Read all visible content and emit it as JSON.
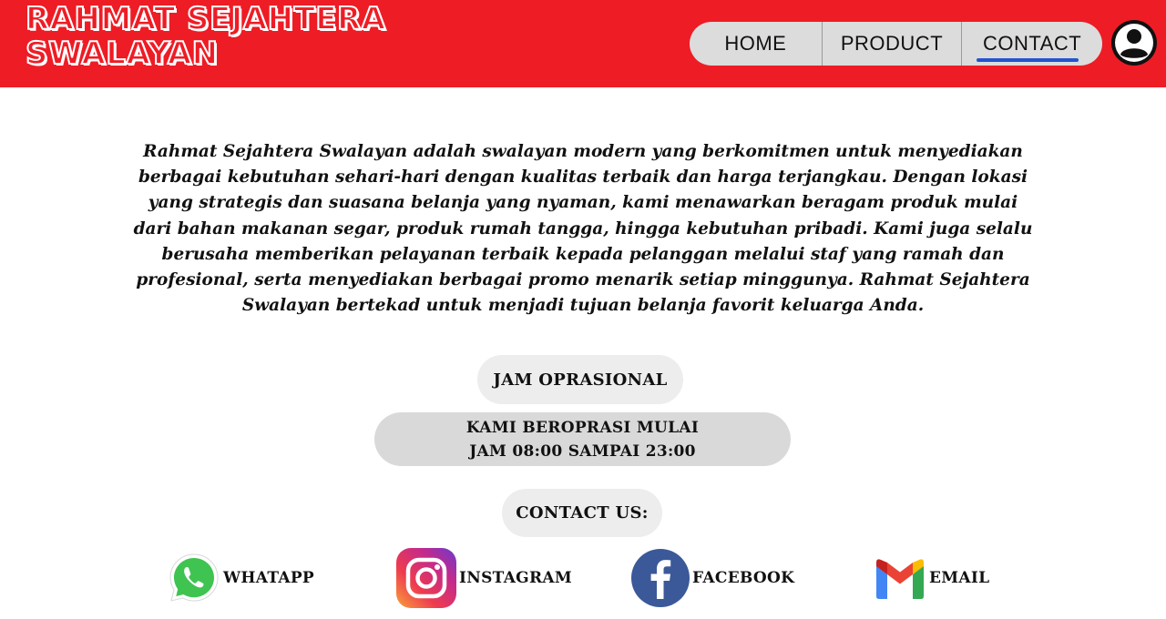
{
  "header": {
    "brand_line1": "RAHMAT SEJAHTERA",
    "brand_line2": "SWALAYAN",
    "nav": {
      "home": "HOME",
      "product": "PRODUCT",
      "contact": "CONTACT"
    },
    "active_tab": "CONTACT",
    "accent_color": "#ee1c25",
    "profile_icon": "user-circle-icon"
  },
  "about": {
    "text": "Rahmat Sejahtera Swalayan adalah swalayan modern yang berkomitmen untuk menyediakan berbagai kebutuhan sehari-hari dengan kualitas terbaik dan harga terjangkau. Dengan lokasi yang strategis dan suasana belanja yang nyaman, kami menawarkan beragam produk mulai dari bahan makanan segar, produk rumah tangga, hingga kebutuhan pribadi. Kami juga selalu berusaha memberikan pelayanan terbaik kepada pelanggan melalui staf yang ramah dan profesional, serta menyediakan berbagai promo menarik setiap minggunya. Rahmat Sejahtera Swalayan bertekad untuk menjadi tujuan belanja favorit keluarga Anda."
  },
  "hours": {
    "title": "JAM OPRASIONAL",
    "line1": "KAMI BEROPRASI MULAI",
    "line2": "JAM 08:00 SAMPAI 23:00"
  },
  "contact": {
    "title": "CONTACT US:",
    "socials": [
      {
        "label": "WHATAPP",
        "icon": "whatsapp-icon"
      },
      {
        "label": "INSTAGRAM",
        "icon": "instagram-icon"
      },
      {
        "label": "FACEBOOK",
        "icon": "facebook-icon"
      },
      {
        "label": "EMAIL",
        "icon": "gmail-icon"
      }
    ]
  }
}
